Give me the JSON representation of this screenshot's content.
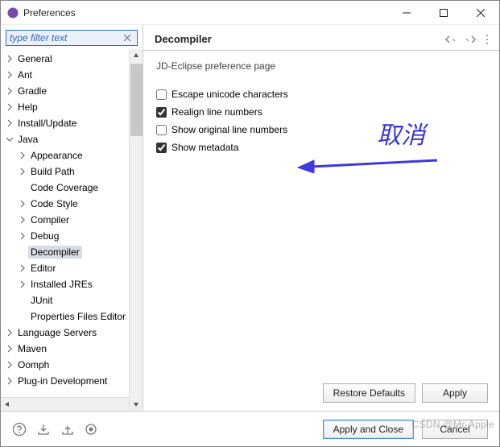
{
  "window": {
    "title": "Preferences"
  },
  "filter": {
    "placeholder": "type filter text",
    "value": ""
  },
  "tree": [
    {
      "label": "General",
      "depth": 0,
      "expandable": true,
      "expanded": false
    },
    {
      "label": "Ant",
      "depth": 0,
      "expandable": true,
      "expanded": false
    },
    {
      "label": "Gradle",
      "depth": 0,
      "expandable": true,
      "expanded": false
    },
    {
      "label": "Help",
      "depth": 0,
      "expandable": true,
      "expanded": false
    },
    {
      "label": "Install/Update",
      "depth": 0,
      "expandable": true,
      "expanded": false
    },
    {
      "label": "Java",
      "depth": 0,
      "expandable": true,
      "expanded": true
    },
    {
      "label": "Appearance",
      "depth": 1,
      "expandable": true,
      "expanded": false
    },
    {
      "label": "Build Path",
      "depth": 1,
      "expandable": true,
      "expanded": false
    },
    {
      "label": "Code Coverage",
      "depth": 1,
      "expandable": false,
      "expanded": false
    },
    {
      "label": "Code Style",
      "depth": 1,
      "expandable": true,
      "expanded": false
    },
    {
      "label": "Compiler",
      "depth": 1,
      "expandable": true,
      "expanded": false
    },
    {
      "label": "Debug",
      "depth": 1,
      "expandable": true,
      "expanded": false
    },
    {
      "label": "Decompiler",
      "depth": 1,
      "expandable": false,
      "expanded": false,
      "selected": true
    },
    {
      "label": "Editor",
      "depth": 1,
      "expandable": true,
      "expanded": false
    },
    {
      "label": "Installed JREs",
      "depth": 1,
      "expandable": true,
      "expanded": false
    },
    {
      "label": "JUnit",
      "depth": 1,
      "expandable": false,
      "expanded": false
    },
    {
      "label": "Properties Files Editor",
      "depth": 1,
      "expandable": false,
      "expanded": false
    },
    {
      "label": "Language Servers",
      "depth": 0,
      "expandable": true,
      "expanded": false
    },
    {
      "label": "Maven",
      "depth": 0,
      "expandable": true,
      "expanded": false
    },
    {
      "label": "Oomph",
      "depth": 0,
      "expandable": true,
      "expanded": false
    },
    {
      "label": "Plug-in Development",
      "depth": 0,
      "expandable": true,
      "expanded": false
    }
  ],
  "page": {
    "title": "Decompiler",
    "description": "JD-Eclipse preference page",
    "options": [
      {
        "label": "Escape unicode characters",
        "checked": false
      },
      {
        "label": "Realign line numbers",
        "checked": true
      },
      {
        "label": "Show original line numbers",
        "checked": false
      },
      {
        "label": "Show metadata",
        "checked": true
      }
    ]
  },
  "annotation": {
    "text": "取消"
  },
  "buttons": {
    "restore_defaults": "Restore Defaults",
    "apply": "Apply",
    "apply_and_close": "Apply and Close",
    "cancel": "Cancel"
  },
  "watermark": "CSDN @Mr·Apple"
}
